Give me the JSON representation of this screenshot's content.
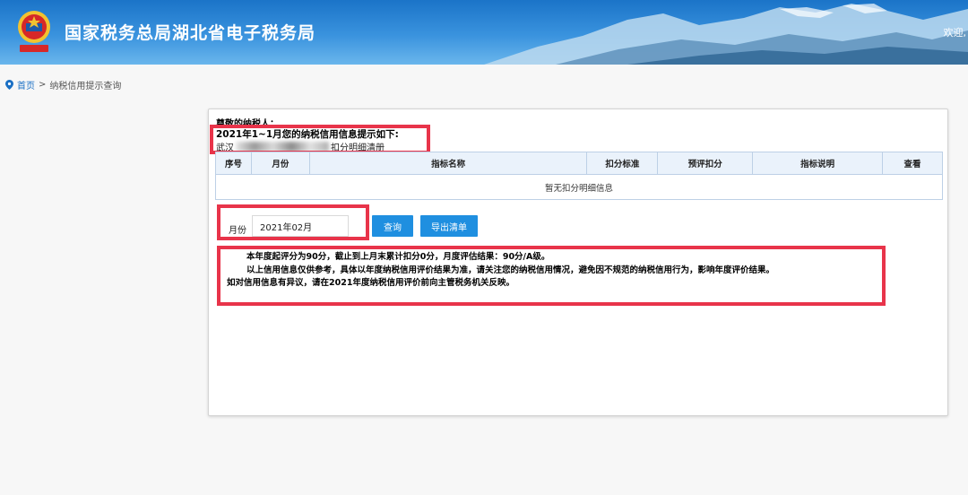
{
  "header": {
    "title": "国家税务总局湖北省电子税务局",
    "welcome": "欢迎,",
    "emblem_color": "#d62828"
  },
  "breadcrumb": {
    "home": "首页",
    "separator": ">",
    "current": "纳税信用提示查询"
  },
  "panel": {
    "greeting": "尊敬的纳税人：",
    "info_title": "2021年1~1月您的纳税信用信息提示如下:",
    "company_prefix": "武汉",
    "list_suffix": "扣分明细清册",
    "table": {
      "columns": [
        "序号",
        "月份",
        "指标名称",
        "扣分标准",
        "预评扣分",
        "指标说明",
        "查看"
      ],
      "empty_text": "暂无扣分明细信息"
    },
    "filter": {
      "month_label": "月份",
      "month_value": "2021年02月",
      "query_button": "查询",
      "export_button": "导出清单"
    },
    "notes": [
      "本年度起评分为90分，截止到上月末累计扣分0分，月度评估结果：90分/A级。",
      "以上信用信息仅供参考，具体以年度纳税信用评价结果为准，请关注您的纳税信用情况，避免因不规范的纳税信用行为，影响年度评价结果。",
      "如对信用信息有异议，请在2021年度纳税信用评价前向主管税务机关反映。"
    ]
  },
  "colors": {
    "accent": "#1f8fe0",
    "highlight_box": "#e8344a"
  }
}
